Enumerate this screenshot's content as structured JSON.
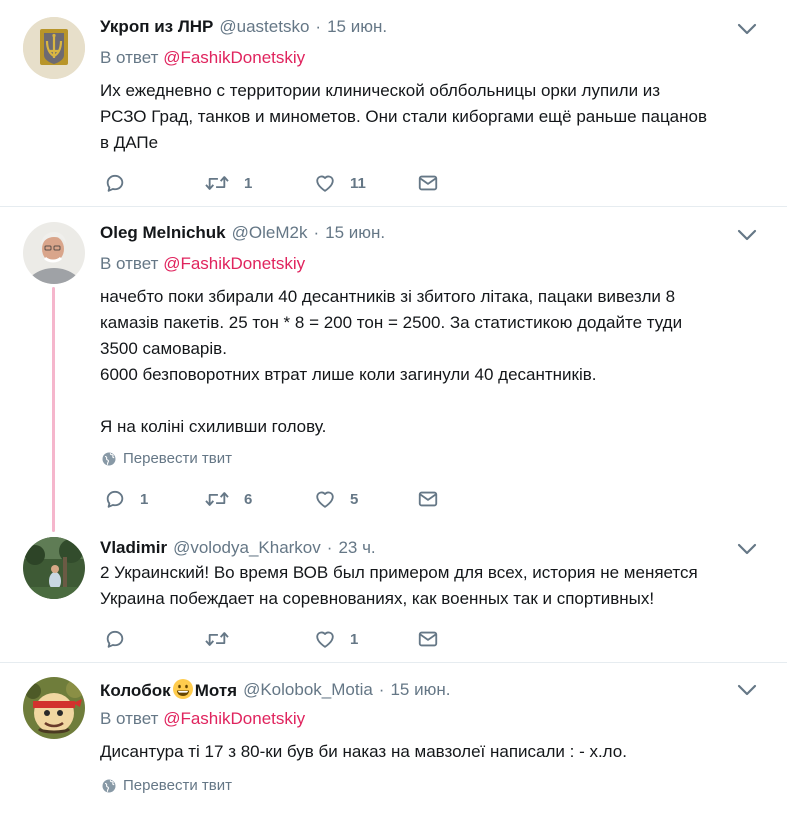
{
  "tweets": [
    {
      "name": "Укроп из ЛНР",
      "handle": "@uastetsko",
      "time": "15 июн.",
      "reply_prefix": "В ответ",
      "reply_to": "@FashikDonetskiy",
      "lines": [
        "Их ежедневно с территории клинической облбольницы орки лупили из",
        "РСЗО Град, танков и минометов. Они стали киборгами  ещё раньше пацанов",
        "в ДАПе"
      ],
      "replies": "",
      "retweets": "1",
      "likes": "11"
    },
    {
      "name": "Oleg Melnichuk",
      "handle": "@OleM2k",
      "time": "15 июн.",
      "reply_prefix": "В ответ",
      "reply_to": "@FashikDonetskiy",
      "lines": [
        "начебто поки збирали 40 десантників зі збитого літака, пацаки вивезли 8",
        "камазів пакетів. 25 тон * 8 = 200 тон = 2500. За статистикою додайте туди",
        "3500 самоварів.",
        "6000 безповоротних втрат лише коли загинули 40 десантників.",
        "",
        "Я на коліні схиливши голову."
      ],
      "translate": "Перевести твит",
      "replies": "1",
      "retweets": "6",
      "likes": "5"
    },
    {
      "name": "Vladimir",
      "handle": "@volodya_Kharkov",
      "time": "23 ч.",
      "lines": [
        "2 Украинский! Во время ВОВ был примером для всех, история не меняется",
        "Украина побеждает на соревнованиях, как военных так и спортивных!"
      ],
      "replies": "",
      "retweets": "",
      "likes": "1"
    },
    {
      "name_part1": "Колобок",
      "name_part2": "Мотя",
      "emoji": "grinning-face-emoji",
      "handle": "@Kolobok_Motia",
      "time": "15 июн.",
      "reply_prefix": "В ответ",
      "reply_to": "@FashikDonetskiy",
      "lines": [
        "Дисантура ті 17 з 80-ки був би наказ на мавзолеї написали : - х.ло."
      ],
      "translate": "Перевести твит"
    }
  ],
  "icons": {
    "reply": "reply-icon",
    "retweet": "retweet-icon",
    "like": "heart-icon",
    "dm": "envelope-icon",
    "caret": "chevron-down-icon",
    "globe": "globe-icon"
  },
  "colors": {
    "link": "#e0245e",
    "muted": "#657786",
    "text": "#14171a",
    "thread_line": "#f5b6cc",
    "divider": "#e6ecf0"
  }
}
